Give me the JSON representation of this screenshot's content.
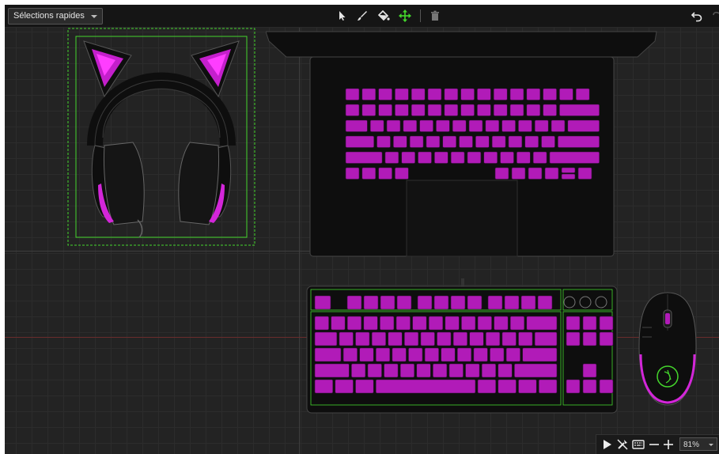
{
  "toolbar": {
    "quick_select_label": "Sélections rapides",
    "tools": [
      {
        "name": "select-tool",
        "icon": "cursor-arrow-icon"
      },
      {
        "name": "brush-tool",
        "icon": "brush-icon"
      },
      {
        "name": "fill-tool",
        "icon": "paint-bucket-icon"
      },
      {
        "name": "move-tool",
        "icon": "move-arrows-icon",
        "active_color": "#44d62c"
      },
      {
        "name": "delete-tool",
        "icon": "trash-icon"
      }
    ],
    "undo_icon": "undo-icon"
  },
  "devices": [
    {
      "name": "Kraken Kitty headset",
      "icon": "headset-icon"
    },
    {
      "name": "Blade laptop",
      "icon": "laptop-icon"
    },
    {
      "name": "Huntsman TKL keyboard",
      "icon": "keyboard-icon"
    },
    {
      "name": "Cobra mouse",
      "icon": "mouse-icon"
    }
  ],
  "colors": {
    "accent": "#44d62c",
    "lighting": "#b11bb8",
    "lighting_bright": "#ff2fff",
    "device_body": "#0e0e0e"
  },
  "bottombar": {
    "play_icon": "play-icon",
    "no_effect_icon": "effect-off-icon",
    "keyboard_view_icon": "keyboard-view-icon",
    "zoom_out_icon": "minus-icon",
    "zoom_in_icon": "plus-icon",
    "zoom_value": "81%"
  }
}
